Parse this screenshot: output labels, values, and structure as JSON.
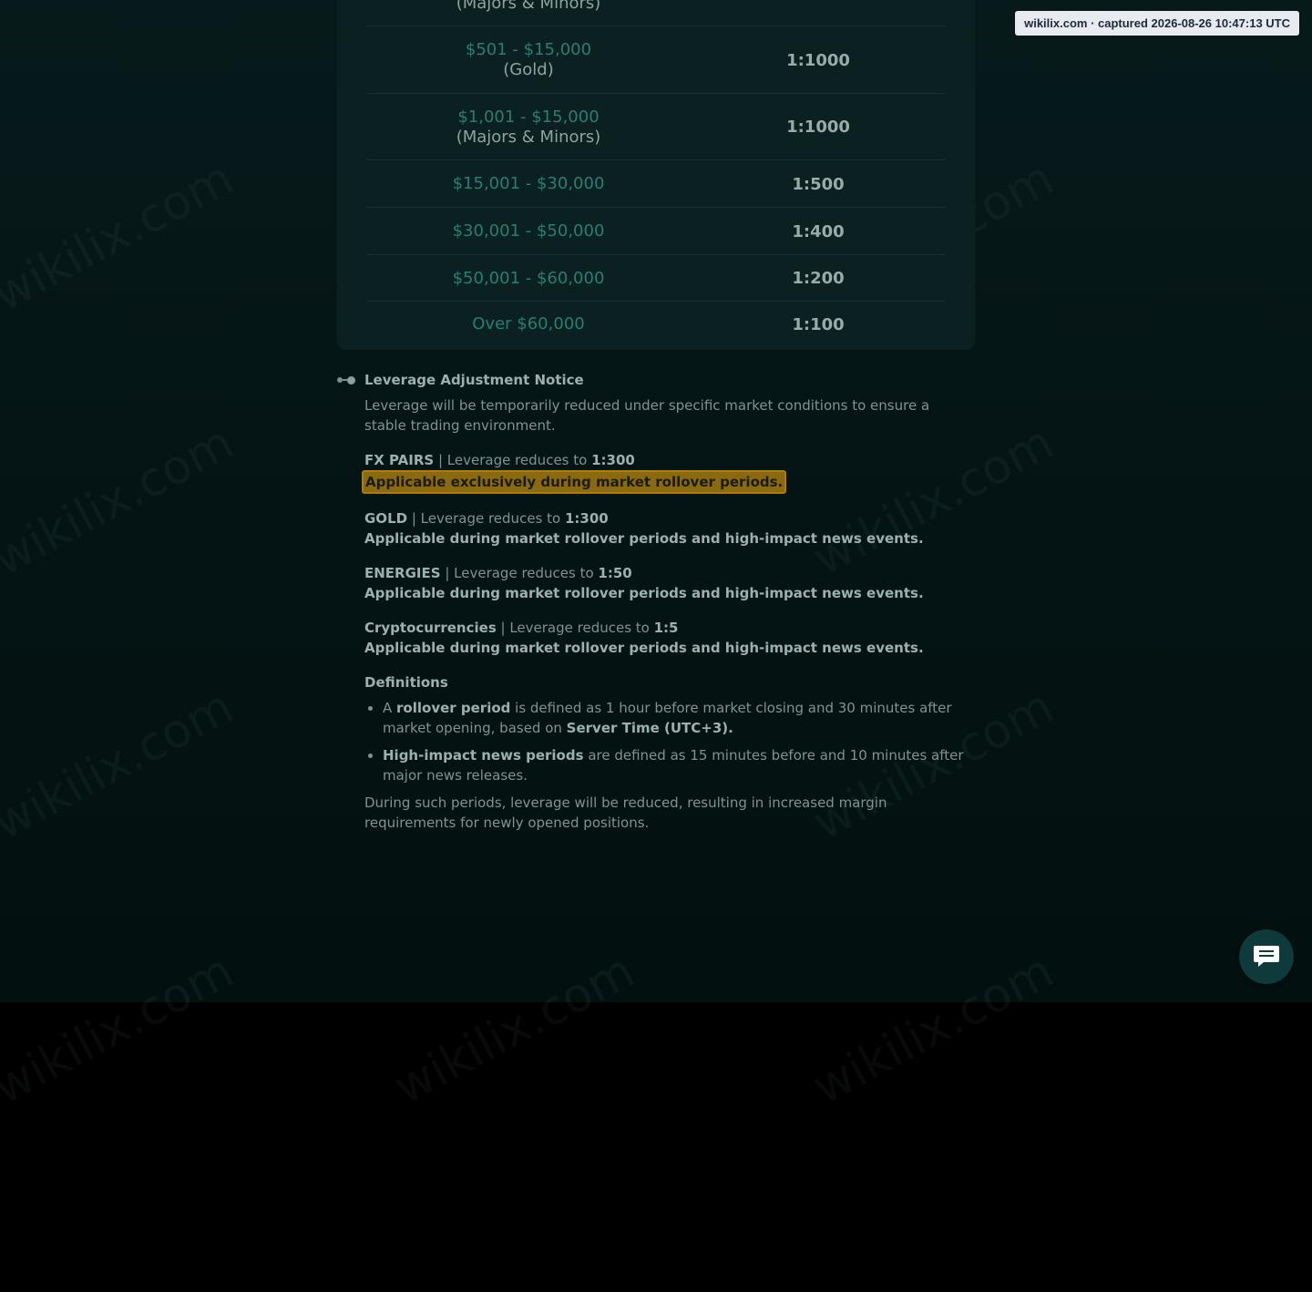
{
  "badge": {
    "text": "wikilix.com · captured 2026-08-26 10:47:13 UTC"
  },
  "watermark_text": "wikilix.com",
  "leverage_table": {
    "rows": [
      {
        "range": "",
        "sub": "(Majors & Minors)",
        "leverage": ""
      },
      {
        "range": "$501 - $15,000",
        "sub": "(Gold)",
        "leverage": "1:1000"
      },
      {
        "range": "$1,001 - $15,000",
        "sub": "(Majors & Minors)",
        "leverage": "1:1000"
      },
      {
        "range": "$15,001 - $30,000",
        "sub": "",
        "leverage": "1:500"
      },
      {
        "range": "$30,001 - $50,000",
        "sub": "",
        "leverage": "1:400"
      },
      {
        "range": "$50,001 - $60,000",
        "sub": "",
        "leverage": "1:200"
      },
      {
        "range": "Over $60,000",
        "sub": "",
        "leverage": "1:100"
      }
    ]
  },
  "notice": {
    "title": "Leverage Adjustment Notice",
    "intro": "Leverage will be temporarily reduced under specific market conditions to ensure a stable trading environment.",
    "items": [
      {
        "name": "FX PAIRS",
        "sep": " | Leverage reduces to ",
        "value": "1:300",
        "note": "Applicable exclusively during market rollover periods."
      },
      {
        "name": "GOLD",
        "sep": " | Leverage reduces to ",
        "value": "1:300",
        "note": "Applicable during market rollover periods and high-impact news events."
      },
      {
        "name": "ENERGIES",
        "sep": " | Leverage reduces to ",
        "value": "1:50",
        "note": "Applicable during market rollover periods and high-impact news events."
      },
      {
        "name": "Cryptocurrencies",
        "sep": " | Leverage reduces to ",
        "value": "1:5",
        "note": "Applicable during market rollover periods and high-impact news events."
      }
    ],
    "definitions_title": "Definitions",
    "def1": {
      "a": "A ",
      "b": "rollover period",
      "c": " is defined as 1 hour before market closing and 30 minutes after market opening, based on ",
      "d": "Server Time (UTC+3)."
    },
    "def2": {
      "b": "High-impact news periods",
      "c": " are defined as 15 minutes before and 10 minutes after major news releases."
    },
    "closing": "During such periods, leverage will be reduced, resulting in increased margin requirements for newly opened positions."
  },
  "colors": {
    "accent": "#2b7d72",
    "highlight": "#8a6a10",
    "background": "#041313"
  },
  "icons": {
    "chat": "chat-bubble-icon",
    "bullet": "timeline-dot-icon"
  }
}
